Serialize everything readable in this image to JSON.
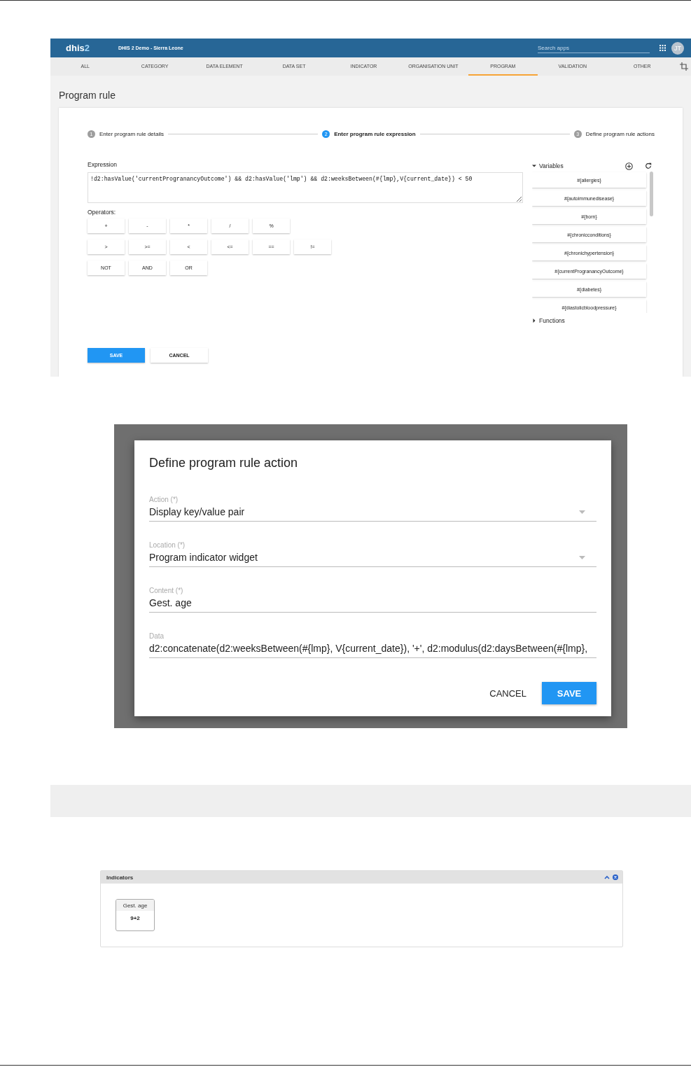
{
  "header": {
    "logo": {
      "text": "dhis",
      "accent": "2"
    },
    "instance": "DHIS 2 Demo - Sierra Leone",
    "search": {
      "placeholder": "Search apps"
    },
    "avatar": "JT"
  },
  "tabs": [
    {
      "label": "ALL",
      "selected": false
    },
    {
      "label": "CATEGORY",
      "selected": false
    },
    {
      "label": "DATA ELEMENT",
      "selected": false
    },
    {
      "label": "DATA SET",
      "selected": false
    },
    {
      "label": "INDICATOR",
      "selected": false
    },
    {
      "label": "ORGANISATION UNIT",
      "selected": false
    },
    {
      "label": "PROGRAM",
      "selected": true
    },
    {
      "label": "VALIDATION",
      "selected": false
    },
    {
      "label": "OTHER",
      "selected": false
    }
  ],
  "page_title": "Program rule",
  "steps": [
    {
      "number": "1",
      "label": "Enter program rule details",
      "selected": false
    },
    {
      "number": "2",
      "label": "Enter program rule expression",
      "selected": true
    },
    {
      "number": "3",
      "label": "Define program rule actions",
      "selected": false
    }
  ],
  "expression": {
    "label": "Expression",
    "value": "!d2:hasValue('currentProgranancyOutcome') && d2:hasValue('lmp') && d2:weeksBetween(#{lmp},V{current_date}) < 50"
  },
  "operators": {
    "label": "Operators:",
    "rows": [
      [
        "+",
        "-",
        "*",
        "/",
        "%"
      ],
      [
        ">",
        ">=",
        "<",
        "<=",
        "==",
        "!="
      ],
      [
        "NOT",
        "AND",
        "OR"
      ]
    ]
  },
  "variables": {
    "label": "Variables",
    "expanded": true,
    "items": [
      "#{allergies}",
      "#{autoimmunedisease}",
      "#{born}",
      "#{chronicconditions}",
      "#{chronichypertension}",
      "#{currentProgranancyOutcome}",
      "#{diabetes}",
      "#{diastolicbloodpressure}"
    ]
  },
  "functions": {
    "label": "Functions",
    "expanded": false
  },
  "buttons": [
    {
      "label": "SAVE",
      "kind": "primary"
    },
    {
      "label": "CANCEL",
      "kind": "secondary"
    }
  ],
  "dialog": {
    "title": "Define program rule action",
    "fields": [
      {
        "label": "Action (*)",
        "value": "Display key/value pair",
        "kind": "select"
      },
      {
        "label": "Location (*)",
        "value": "Program indicator widget",
        "kind": "select"
      },
      {
        "label": "Content (*)",
        "value": "Gest. age",
        "kind": "text"
      },
      {
        "label": "Data",
        "value": "d2:concatenate(d2:weeksBetween(#{lmp}, V{current_date}), '+', d2:modulus(d2:daysBetween(#{lmp},",
        "kind": "text"
      }
    ],
    "buttons": [
      {
        "label": "CANCEL",
        "kind": "secondary"
      },
      {
        "label": "SAVE",
        "kind": "primary"
      }
    ]
  },
  "indicators_widget": {
    "title": "Indicators",
    "expanded": true,
    "indicators": [
      {
        "name": "Gest. age",
        "value": "9+2"
      }
    ]
  }
}
